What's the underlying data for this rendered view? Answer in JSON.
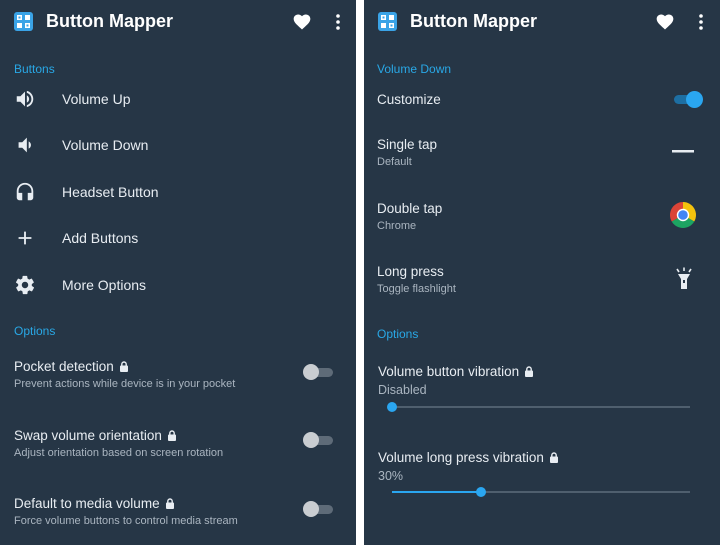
{
  "colors": {
    "background": "#263646",
    "accent": "#29a8e6",
    "text": "#e8edf2",
    "subtext": "#aab5c0"
  },
  "left": {
    "app_title": "Button Mapper",
    "section_buttons": "Buttons",
    "buttons": [
      {
        "label": "Volume Up",
        "icon": "volume-up-icon"
      },
      {
        "label": "Volume Down",
        "icon": "volume-down-icon"
      },
      {
        "label": "Headset Button",
        "icon": "headset-icon"
      },
      {
        "label": "Add Buttons",
        "icon": "plus-icon"
      },
      {
        "label": "More Options",
        "icon": "gear-icon"
      }
    ],
    "section_options": "Options",
    "options": [
      {
        "title": "Pocket detection",
        "subtitle": "Prevent actions while device is in your pocket",
        "enabled": false,
        "locked": true
      },
      {
        "title": "Swap volume orientation",
        "subtitle": "Adjust orientation based on screen rotation",
        "enabled": false,
        "locked": true
      },
      {
        "title": "Default to media volume",
        "subtitle": "Force volume buttons to control media stream",
        "enabled": false,
        "locked": true
      }
    ]
  },
  "right": {
    "app_title": "Button Mapper",
    "section_button": "Volume Down",
    "customize": {
      "label": "Customize",
      "enabled": true
    },
    "actions": [
      {
        "title": "Single tap",
        "value": "Default",
        "icon": "dash-icon"
      },
      {
        "title": "Double tap",
        "value": "Chrome",
        "icon": "chrome-icon"
      },
      {
        "title": "Long press",
        "value": "Toggle flashlight",
        "icon": "flashlight-icon"
      }
    ],
    "section_options": "Options",
    "sliders": [
      {
        "title": "Volume button vibration",
        "value_text": "Disabled",
        "value_fraction": 0.0,
        "locked": true
      },
      {
        "title": "Volume long press vibration",
        "value_text": "30%",
        "value_fraction": 0.3,
        "locked": true
      }
    ]
  }
}
